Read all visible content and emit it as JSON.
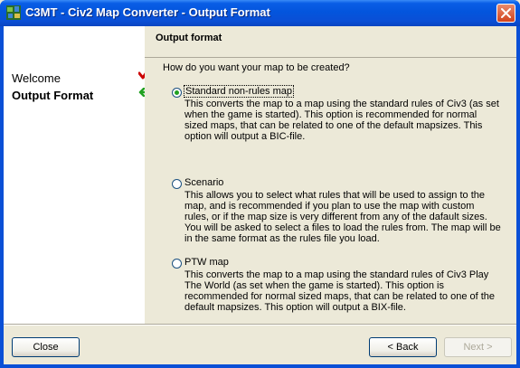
{
  "window": {
    "title": "C3MT - Civ2 Map Converter - Output Format",
    "colors": {
      "titlebar": "#0a4fd6",
      "close": "#d2421c",
      "face": "#ece9d8",
      "check": "#cc0000",
      "arrow": "#21a121"
    }
  },
  "sidebar": {
    "items": [
      {
        "label": "Welcome",
        "status": "done",
        "icon": "check-icon"
      },
      {
        "label": "Output Format",
        "status": "current",
        "icon": "arrow-left-icon"
      }
    ]
  },
  "page": {
    "header": "Output format",
    "question": "How do you want your map to be created?",
    "options": [
      {
        "label": "Standard non-rules map",
        "selected": true,
        "description": "This converts the map to a map using the standard rules of Civ3 (as set when the game is started). This option is recommended for normal sized maps, that can be related to one of the default mapsizes. This option will output a BIC-file."
      },
      {
        "label": "Scenario",
        "selected": false,
        "description": "This allows you to select what rules that will be used to assign to the map, and is recommended if you plan to use the map with custom rules, or if the map size is very different from any of the dafault sizes. You will be asked to select a files to load the rules from. The map will be in the same format as the rules file you load."
      },
      {
        "label": "PTW map",
        "selected": false,
        "description": "This converts the map to a map using the standard rules of Civ3 Play The World (as set when the game is started). This option is recommended for normal sized maps, that can be related to one of the default mapsizes. This option will output a BIX-file."
      }
    ]
  },
  "buttons": {
    "close": "Close",
    "back": "< Back",
    "next": "Next >",
    "next_enabled": false
  }
}
